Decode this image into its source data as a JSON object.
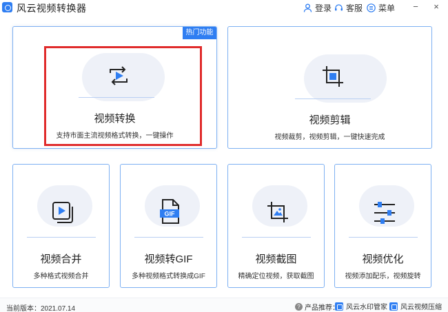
{
  "app": {
    "title": "风云视频转换器"
  },
  "titlebar": {
    "login": "登录",
    "support": "客服",
    "menu": "菜单",
    "minimize": "−",
    "close": "×"
  },
  "cards": {
    "convert": {
      "badge": "热门功能",
      "title": "视频转换",
      "desc": "支持市面主流视频格式转换，一键操作",
      "icon": "convert-play-icon"
    },
    "edit": {
      "title": "视频剪辑",
      "desc": "视频裁剪，视频剪辑，一键快速完成",
      "icon": "crop-icon"
    },
    "merge": {
      "title": "视频合并",
      "desc": "多种格式视频合并",
      "icon": "merge-play-icon"
    },
    "gif": {
      "title": "视频转GIF",
      "desc": "多种视频格式转换成GIF",
      "gif_label": "GIF",
      "icon": "gif-file-icon"
    },
    "capture": {
      "title": "视频截图",
      "desc": "精确定位视频，获取截图",
      "icon": "crop-image-icon"
    },
    "optimize": {
      "title": "视频优化",
      "desc": "视频添加配乐，视频旋转",
      "icon": "sliders-icon"
    }
  },
  "footer": {
    "version": "当前版本：2021.07.14",
    "rec_label": "产品推荐：",
    "product1": "风云水印管家",
    "product2": "风云视频压缩"
  },
  "colors": {
    "accent": "#2f7ef2",
    "border": "#7db0f2",
    "highlight": "#e02b2b"
  }
}
